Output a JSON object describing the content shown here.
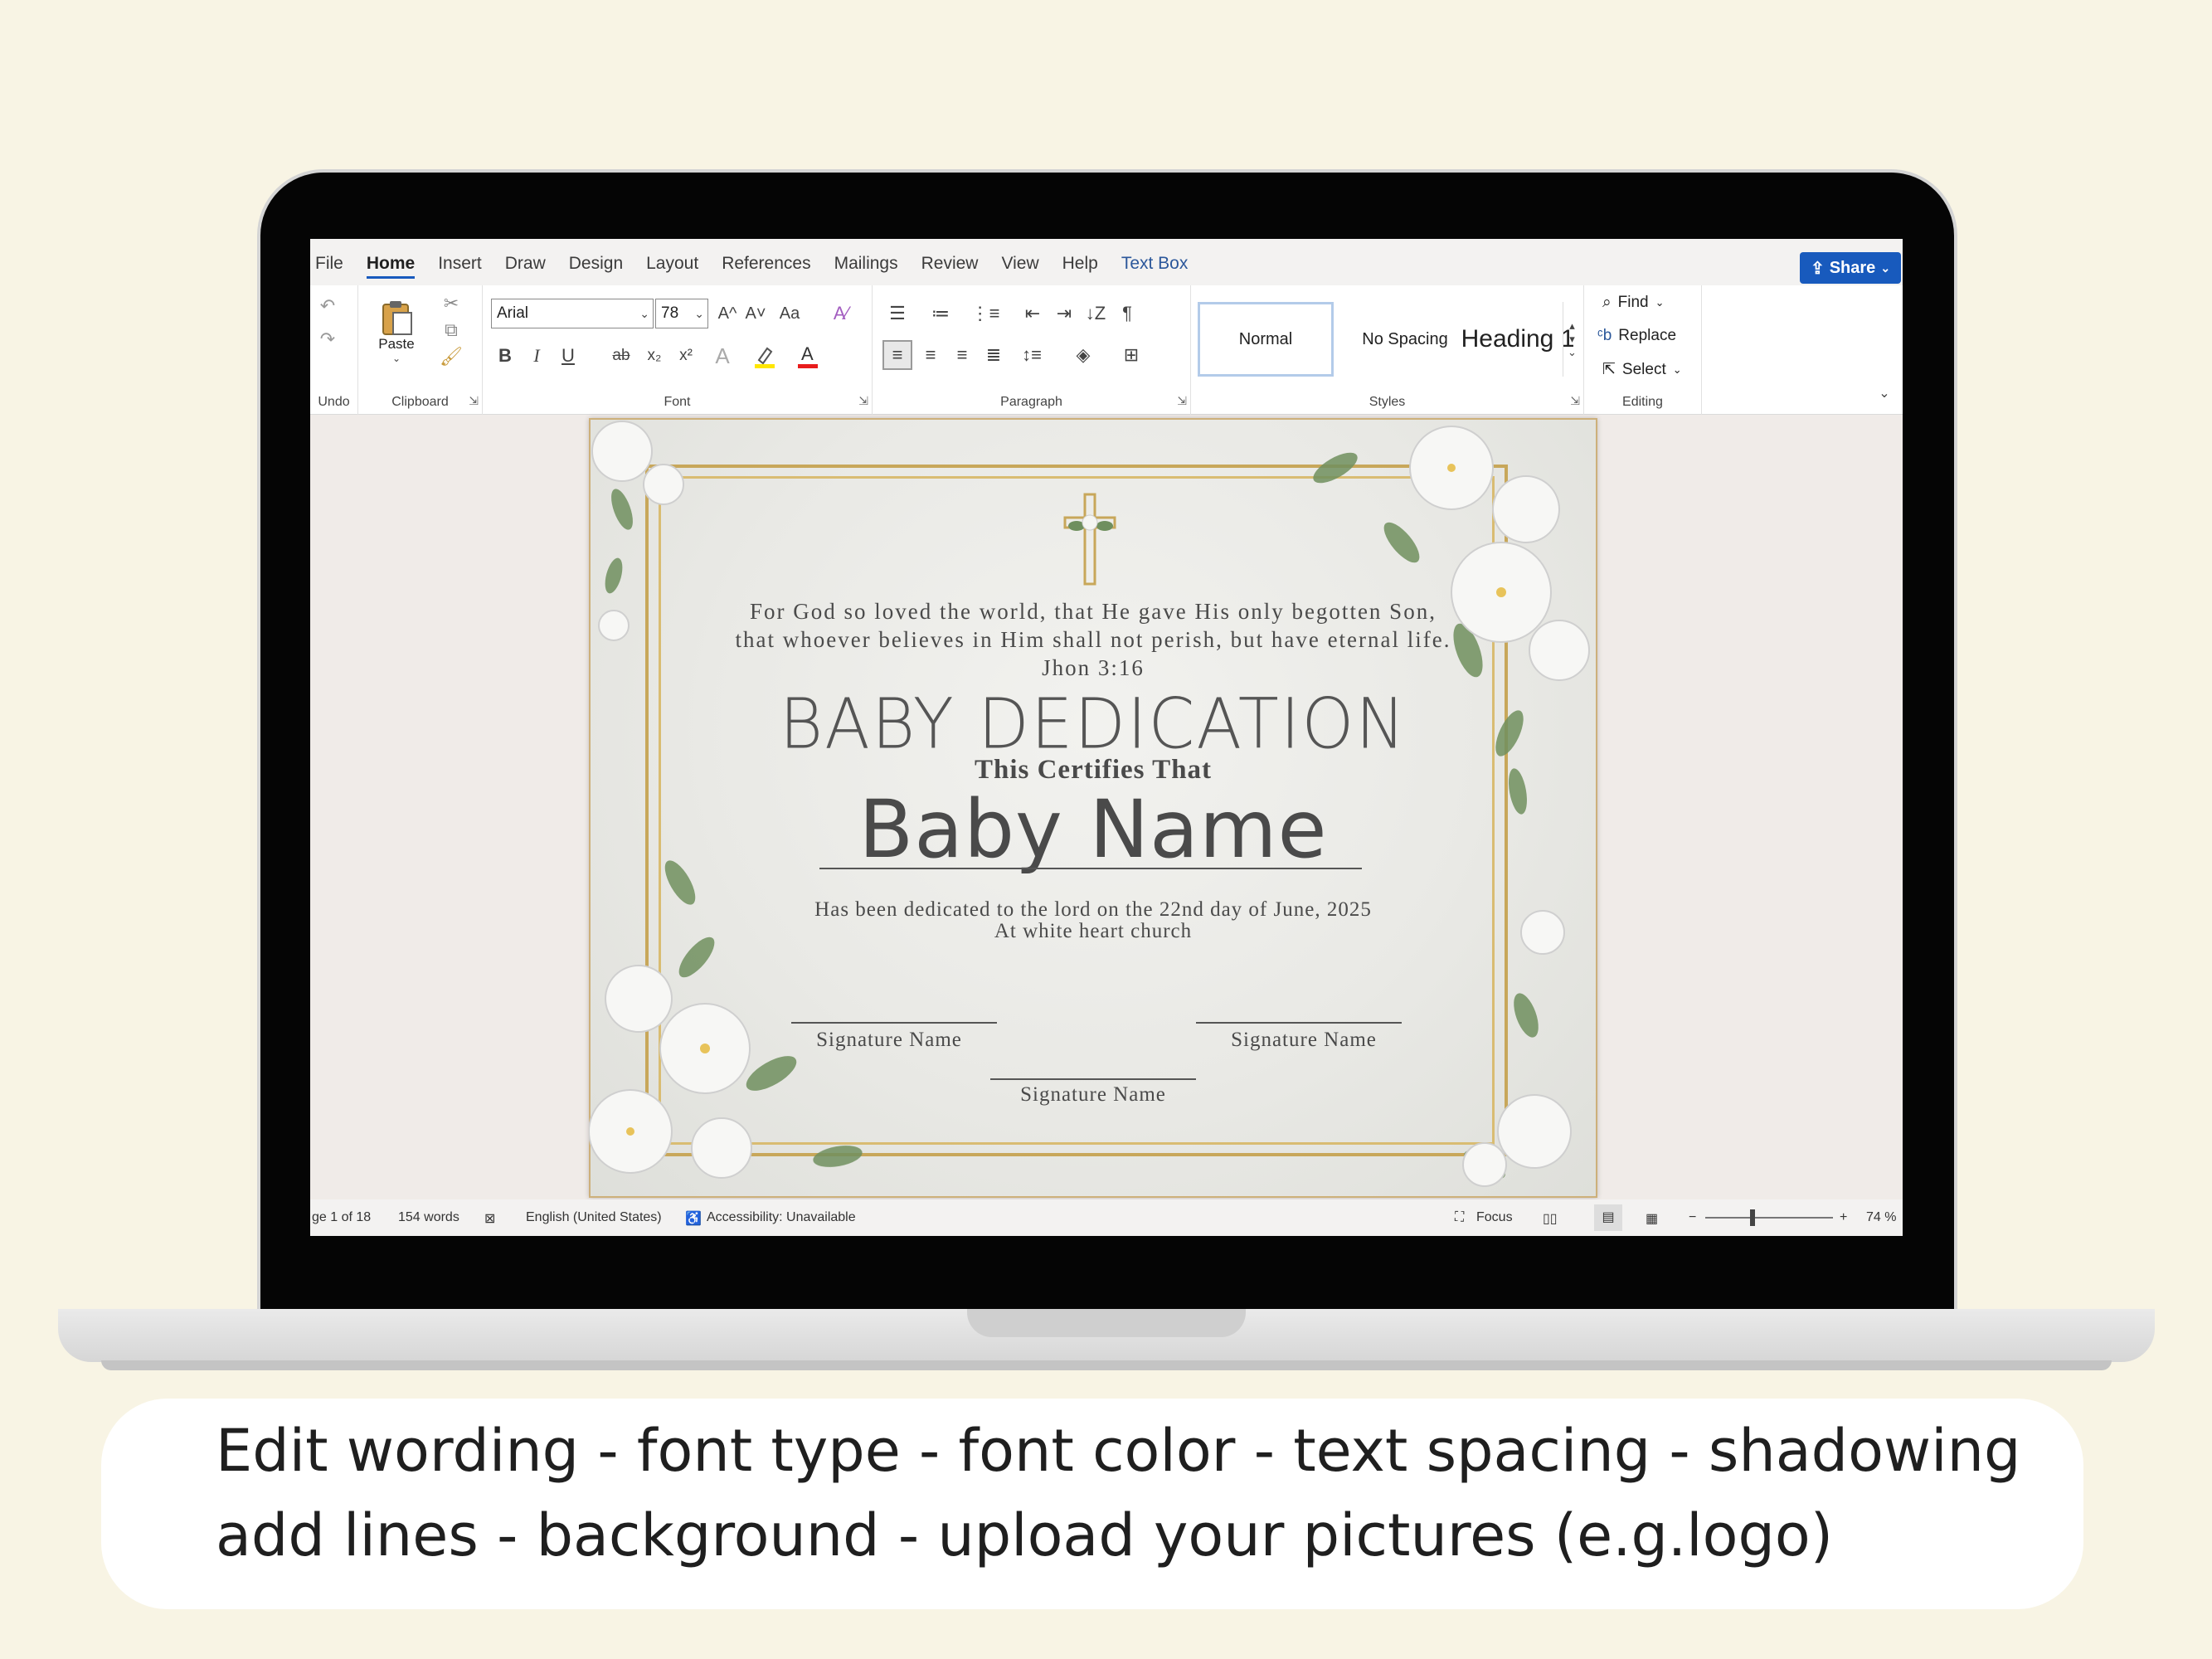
{
  "window": {
    "tabs": [
      "File",
      "Home",
      "Insert",
      "Draw",
      "Design",
      "Layout",
      "References",
      "Mailings",
      "Review",
      "View",
      "Help",
      "Text Box"
    ],
    "active_tab": "Home",
    "share_label": "Share"
  },
  "ribbon": {
    "groups": {
      "undo": "Undo",
      "clipboard": "Clipboard",
      "font": "Font",
      "paragraph": "Paragraph",
      "styles": "Styles",
      "editing": "Editing"
    },
    "paste_label": "Paste",
    "font_name": "Arial",
    "font_size": "78",
    "grow_font": "A^",
    "shrink_font": "A˅",
    "change_case": "Aa",
    "bold": "B",
    "italic": "I",
    "underline": "U",
    "strikethrough": "ab",
    "subscript": "x₂",
    "superscript": "x²",
    "styles": [
      "Normal",
      "No Spacing",
      "Heading 1"
    ],
    "editing": {
      "find": "Find",
      "replace": "Replace",
      "select": "Select"
    }
  },
  "document": {
    "verse": "For God so loved the world, that He gave His only begotten Son, that whoever believes in Him shall not perish, but have eternal life. Jhon 3:16",
    "title": "BABY DEDICATION",
    "certifies": "This Certifies That",
    "baby_name": "Baby Name",
    "dedicated_line1": "Has been dedicated to the lord on   the 22nd day of June, 2025",
    "dedicated_line2": "At white heart church",
    "signatures": [
      "Signature Name",
      "Signature Name",
      "Signature Name"
    ]
  },
  "statusbar": {
    "page": "ge 1 of 18",
    "words": "154 words",
    "language": "English (United States)",
    "accessibility": "Accessibility: Unavailable",
    "focus": "Focus",
    "zoom": "74 %"
  },
  "caption": {
    "line1": "Edit wording - font type - font color - text spacing - shadowing",
    "line2": "add lines - background -  upload your pictures (e.g.logo)"
  },
  "colors": {
    "background": "#f8f4e4",
    "accent": "#185abd",
    "gold_frame": "#c8a75a",
    "leaf_green": "#6f8f5e"
  },
  "icons": [
    "undo-icon",
    "redo-icon",
    "paste-icon",
    "cut-icon",
    "copy-icon",
    "format-painter-icon",
    "cross-icon",
    "find-icon",
    "replace-icon",
    "select-icon"
  ]
}
